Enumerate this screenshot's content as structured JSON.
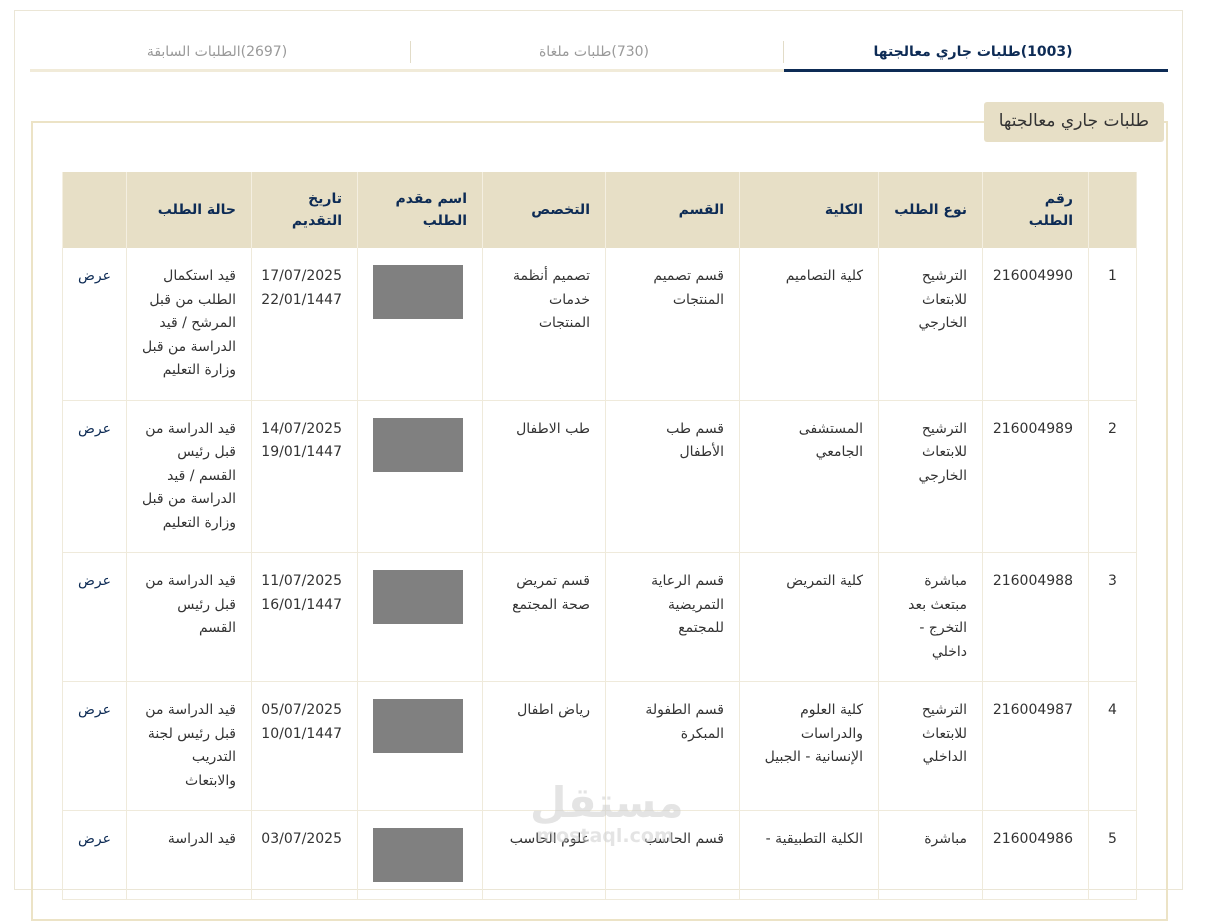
{
  "tabs": [
    {
      "label": "طلبات جاري معالجتها",
      "count": "(1003)"
    },
    {
      "label": "طلبات ملغاة",
      "count": "(730)"
    },
    {
      "label": "الطلبات السابقة",
      "count": "(2697)"
    }
  ],
  "section_title": "طلبات جاري معالجتها",
  "table": {
    "headers": [
      "",
      "رقم الطلب",
      "نوع الطلب",
      "الكلية",
      "القسم",
      "التخصص",
      "اسم مقدم الطلب",
      "تاريخ التقديم",
      "حالة الطلب",
      ""
    ],
    "rows": [
      {
        "idx": "1",
        "id": "216004990",
        "type": "الترشيح للابتعاث الخارجي",
        "college": "كلية التصاميم",
        "dept": "قسم تصميم المنتجات",
        "major": "تصميم أنظمة خدمات المنتجات",
        "date_g": "17/07/2025",
        "date_h": "22/01/1447",
        "status": "قيد استكمال الطلب من قبل المرشح / قيد الدراسة من قبل وزارة التعليم",
        "action": "عرض"
      },
      {
        "idx": "2",
        "id": "216004989",
        "type": "الترشيح للابتعاث الخارجي",
        "college": "المستشفى الجامعي",
        "dept": "قسم طب الأطفال",
        "major": "طب الاطفال",
        "date_g": "14/07/2025",
        "date_h": "19/01/1447",
        "status": "قيد الدراسة من قبل رئيس القسم / قيد الدراسة من قبل وزارة التعليم",
        "action": "عرض"
      },
      {
        "idx": "3",
        "id": "216004988",
        "type": "مباشرة مبتعث بعد التخرج - داخلي",
        "college": "كلية التمريض",
        "dept": "قسم الرعاية التمريضية للمجتمع",
        "major": "قسم تمريض صحة المجتمع",
        "date_g": "11/07/2025",
        "date_h": "16/01/1447",
        "status": "قيد الدراسة من قبل رئيس القسم",
        "action": "عرض"
      },
      {
        "idx": "4",
        "id": "216004987",
        "type": "الترشيح للابتعاث الداخلي",
        "college": "كلية العلوم والدراسات الإنسانية - الجبيل",
        "dept": "قسم الطفولة المبكرة",
        "major": "رياض اطفال",
        "date_g": "05/07/2025",
        "date_h": "10/01/1447",
        "status": "قيد الدراسة من قبل رئيس لجنة التدريب والابتعاث",
        "action": "عرض"
      },
      {
        "idx": "5",
        "id": "216004986",
        "type": "مباشرة",
        "college": "الكلية التطبيقية -",
        "dept": "قسم الحاسب",
        "major": "علوم الحاسب",
        "date_g": "03/07/2025",
        "date_h": "",
        "status": "قيد الدراسة",
        "action": "عرض"
      }
    ]
  },
  "watermark": {
    "ar": "مستقل",
    "en": "mostaql.com"
  }
}
